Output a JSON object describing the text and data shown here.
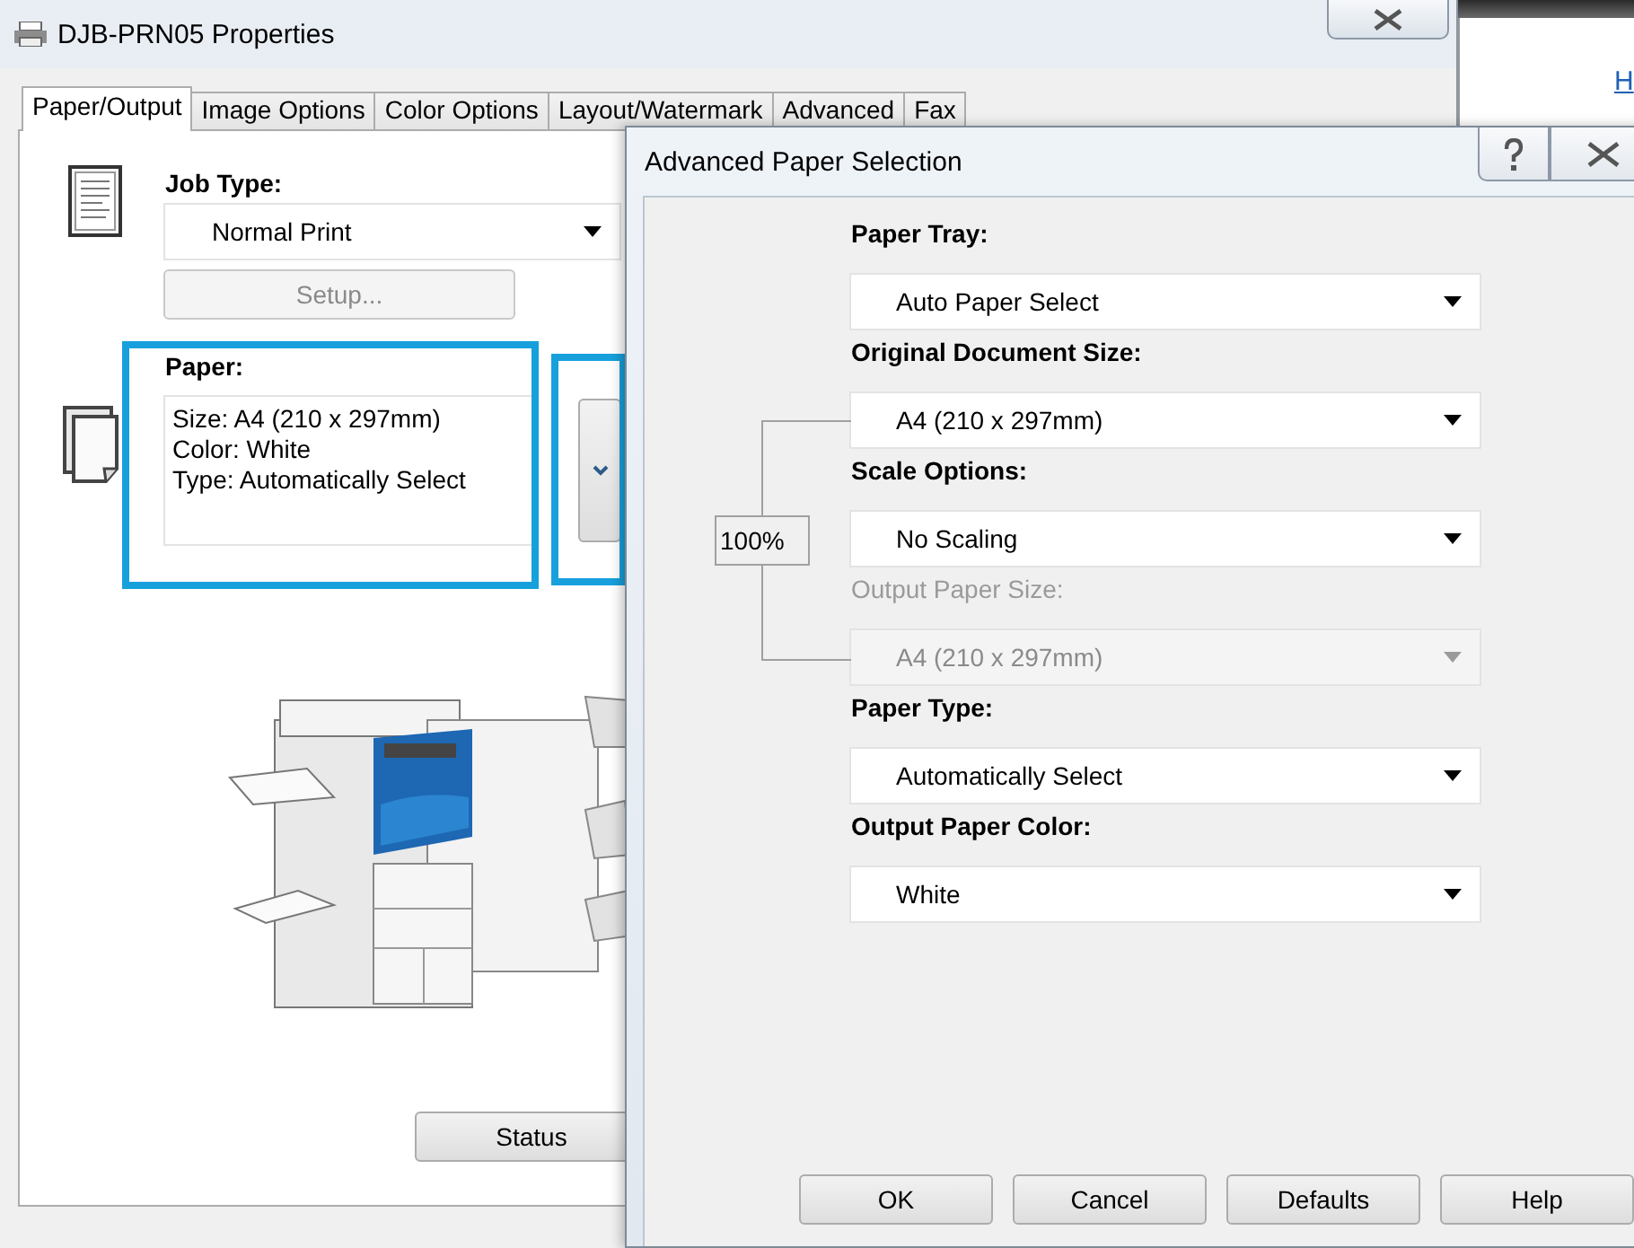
{
  "properties_window": {
    "title": "DJB-PRN05 Properties",
    "tabs": [
      {
        "label": "Paper/Output",
        "selected": true
      },
      {
        "label": "Image Options",
        "selected": false
      },
      {
        "label": "Color Options",
        "selected": false
      },
      {
        "label": "Layout/Watermark",
        "selected": false
      },
      {
        "label": "Advanced",
        "selected": false
      },
      {
        "label": "Fax",
        "selected": false
      }
    ],
    "job_type": {
      "label": "Job Type:",
      "value": "Normal Print"
    },
    "setup_button": {
      "label": "Setup...",
      "disabled": true
    },
    "paper": {
      "label": "Paper:",
      "lines": [
        "Size: A4 (210 x 297mm)",
        "Color: White",
        "Type: Automatically Select"
      ],
      "highlighted": true
    },
    "expand_button": {
      "highlighted": true
    },
    "status_button": "Status"
  },
  "side_window": {
    "link": "H"
  },
  "dialog": {
    "title": "Advanced Paper Selection",
    "fields": [
      {
        "label": "Paper Tray:",
        "value": "Auto Paper Select",
        "disabled": false
      },
      {
        "label": "Original Document Size:",
        "value": "A4 (210 x 297mm)",
        "disabled": false
      },
      {
        "label": "Scale Options:",
        "value": "No Scaling",
        "disabled": false
      },
      {
        "label": "Output Paper Size:",
        "value": "A4 (210 x 297mm)",
        "disabled": true
      },
      {
        "label": "Paper Type:",
        "value": "Automatically Select",
        "disabled": false
      },
      {
        "label": "Output Paper Color:",
        "value": "White",
        "disabled": false
      }
    ],
    "scale_percent": "100%",
    "buttons": [
      "OK",
      "Cancel",
      "Defaults",
      "Help"
    ]
  }
}
